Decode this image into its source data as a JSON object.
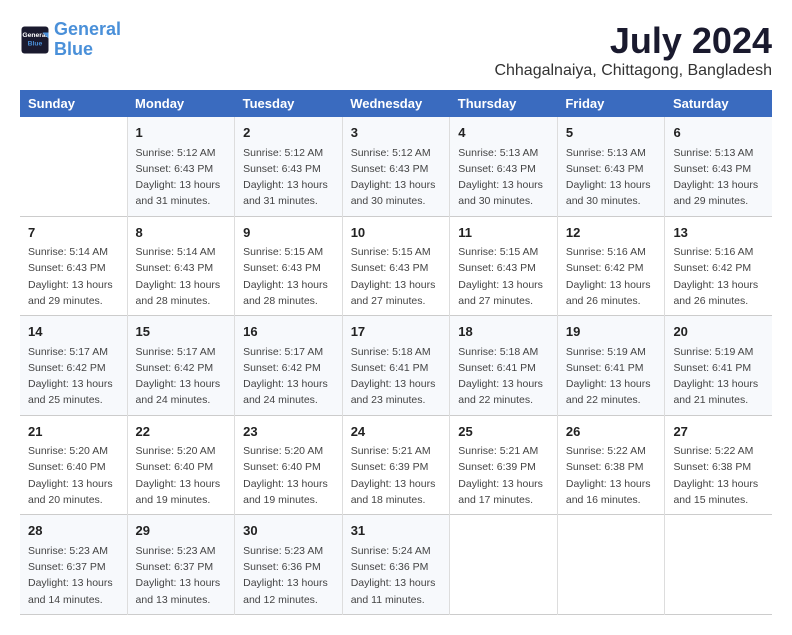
{
  "header": {
    "logo_line1": "General",
    "logo_line2": "Blue",
    "month_title": "July 2024",
    "location": "Chhagalnaiya, Chittagong, Bangladesh"
  },
  "weekdays": [
    "Sunday",
    "Monday",
    "Tuesday",
    "Wednesday",
    "Thursday",
    "Friday",
    "Saturday"
  ],
  "weeks": [
    [
      {
        "day": "",
        "sunrise": "",
        "sunset": "",
        "daylight": ""
      },
      {
        "day": "1",
        "sunrise": "5:12 AM",
        "sunset": "6:43 PM",
        "daylight": "13 hours and 31 minutes."
      },
      {
        "day": "2",
        "sunrise": "5:12 AM",
        "sunset": "6:43 PM",
        "daylight": "13 hours and 31 minutes."
      },
      {
        "day": "3",
        "sunrise": "5:12 AM",
        "sunset": "6:43 PM",
        "daylight": "13 hours and 30 minutes."
      },
      {
        "day": "4",
        "sunrise": "5:13 AM",
        "sunset": "6:43 PM",
        "daylight": "13 hours and 30 minutes."
      },
      {
        "day": "5",
        "sunrise": "5:13 AM",
        "sunset": "6:43 PM",
        "daylight": "13 hours and 30 minutes."
      },
      {
        "day": "6",
        "sunrise": "5:13 AM",
        "sunset": "6:43 PM",
        "daylight": "13 hours and 29 minutes."
      }
    ],
    [
      {
        "day": "7",
        "sunrise": "5:14 AM",
        "sunset": "6:43 PM",
        "daylight": "13 hours and 29 minutes."
      },
      {
        "day": "8",
        "sunrise": "5:14 AM",
        "sunset": "6:43 PM",
        "daylight": "13 hours and 28 minutes."
      },
      {
        "day": "9",
        "sunrise": "5:15 AM",
        "sunset": "6:43 PM",
        "daylight": "13 hours and 28 minutes."
      },
      {
        "day": "10",
        "sunrise": "5:15 AM",
        "sunset": "6:43 PM",
        "daylight": "13 hours and 27 minutes."
      },
      {
        "day": "11",
        "sunrise": "5:15 AM",
        "sunset": "6:43 PM",
        "daylight": "13 hours and 27 minutes."
      },
      {
        "day": "12",
        "sunrise": "5:16 AM",
        "sunset": "6:42 PM",
        "daylight": "13 hours and 26 minutes."
      },
      {
        "day": "13",
        "sunrise": "5:16 AM",
        "sunset": "6:42 PM",
        "daylight": "13 hours and 26 minutes."
      }
    ],
    [
      {
        "day": "14",
        "sunrise": "5:17 AM",
        "sunset": "6:42 PM",
        "daylight": "13 hours and 25 minutes."
      },
      {
        "day": "15",
        "sunrise": "5:17 AM",
        "sunset": "6:42 PM",
        "daylight": "13 hours and 24 minutes."
      },
      {
        "day": "16",
        "sunrise": "5:17 AM",
        "sunset": "6:42 PM",
        "daylight": "13 hours and 24 minutes."
      },
      {
        "day": "17",
        "sunrise": "5:18 AM",
        "sunset": "6:41 PM",
        "daylight": "13 hours and 23 minutes."
      },
      {
        "day": "18",
        "sunrise": "5:18 AM",
        "sunset": "6:41 PM",
        "daylight": "13 hours and 22 minutes."
      },
      {
        "day": "19",
        "sunrise": "5:19 AM",
        "sunset": "6:41 PM",
        "daylight": "13 hours and 22 minutes."
      },
      {
        "day": "20",
        "sunrise": "5:19 AM",
        "sunset": "6:41 PM",
        "daylight": "13 hours and 21 minutes."
      }
    ],
    [
      {
        "day": "21",
        "sunrise": "5:20 AM",
        "sunset": "6:40 PM",
        "daylight": "13 hours and 20 minutes."
      },
      {
        "day": "22",
        "sunrise": "5:20 AM",
        "sunset": "6:40 PM",
        "daylight": "13 hours and 19 minutes."
      },
      {
        "day": "23",
        "sunrise": "5:20 AM",
        "sunset": "6:40 PM",
        "daylight": "13 hours and 19 minutes."
      },
      {
        "day": "24",
        "sunrise": "5:21 AM",
        "sunset": "6:39 PM",
        "daylight": "13 hours and 18 minutes."
      },
      {
        "day": "25",
        "sunrise": "5:21 AM",
        "sunset": "6:39 PM",
        "daylight": "13 hours and 17 minutes."
      },
      {
        "day": "26",
        "sunrise": "5:22 AM",
        "sunset": "6:38 PM",
        "daylight": "13 hours and 16 minutes."
      },
      {
        "day": "27",
        "sunrise": "5:22 AM",
        "sunset": "6:38 PM",
        "daylight": "13 hours and 15 minutes."
      }
    ],
    [
      {
        "day": "28",
        "sunrise": "5:23 AM",
        "sunset": "6:37 PM",
        "daylight": "13 hours and 14 minutes."
      },
      {
        "day": "29",
        "sunrise": "5:23 AM",
        "sunset": "6:37 PM",
        "daylight": "13 hours and 13 minutes."
      },
      {
        "day": "30",
        "sunrise": "5:23 AM",
        "sunset": "6:36 PM",
        "daylight": "13 hours and 12 minutes."
      },
      {
        "day": "31",
        "sunrise": "5:24 AM",
        "sunset": "6:36 PM",
        "daylight": "13 hours and 11 minutes."
      },
      {
        "day": "",
        "sunrise": "",
        "sunset": "",
        "daylight": ""
      },
      {
        "day": "",
        "sunrise": "",
        "sunset": "",
        "daylight": ""
      },
      {
        "day": "",
        "sunrise": "",
        "sunset": "",
        "daylight": ""
      }
    ]
  ],
  "labels": {
    "sunrise_prefix": "Sunrise: ",
    "sunset_prefix": "Sunset: ",
    "daylight_label": "Daylight: "
  }
}
